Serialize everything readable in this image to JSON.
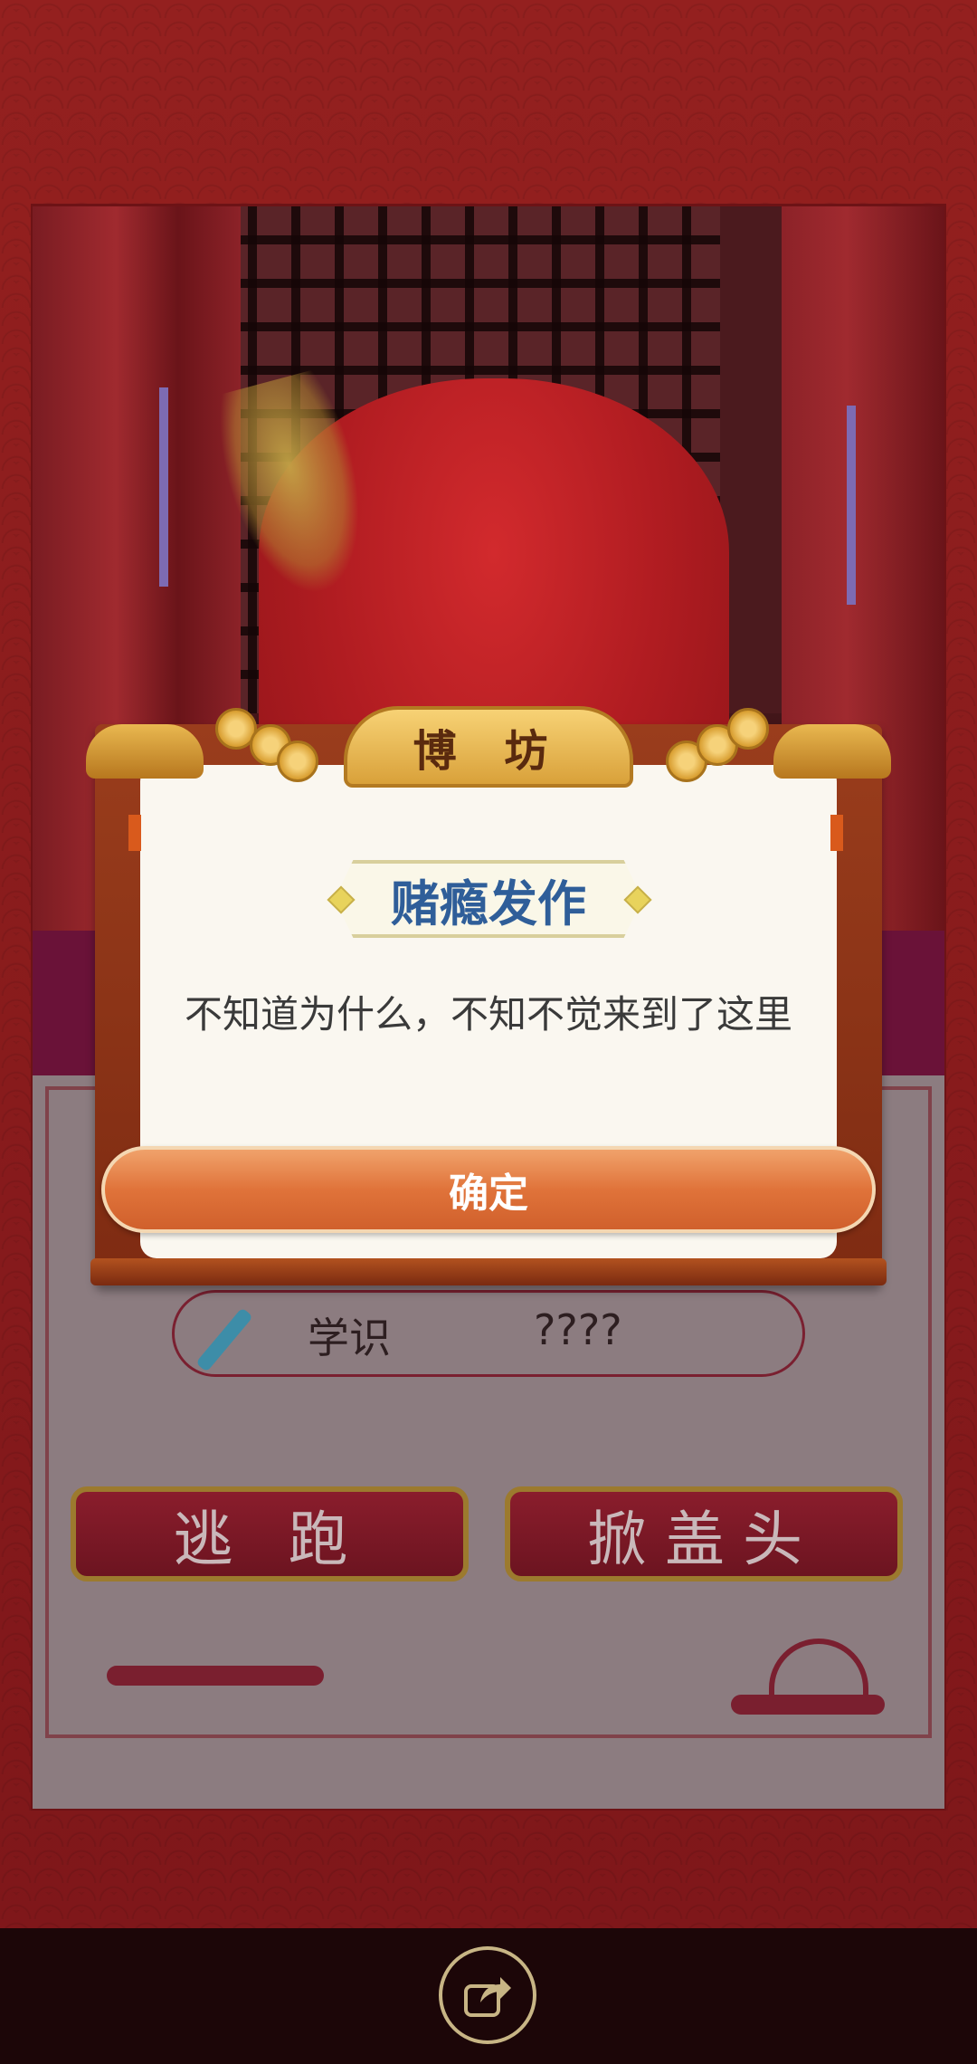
{
  "dialog": {
    "header_title": "博 坊",
    "subtitle": "赌瘾发作",
    "message": "不知道为什么，不知不觉来到了这里",
    "confirm_label": "确定"
  },
  "stats": {
    "knowledge_label": "学识",
    "knowledge_value": "????"
  },
  "actions": {
    "escape_label": "逃 跑",
    "lift_veil_label": "掀盖头"
  },
  "icons": {
    "share": "share-arrow-icon",
    "knowledge": "brush-icon"
  },
  "colors": {
    "background": "#8e1a1e",
    "confirm_button": "#e0733a",
    "subtitle_text": "#2f5e99",
    "action_button": "#7a1a26"
  }
}
